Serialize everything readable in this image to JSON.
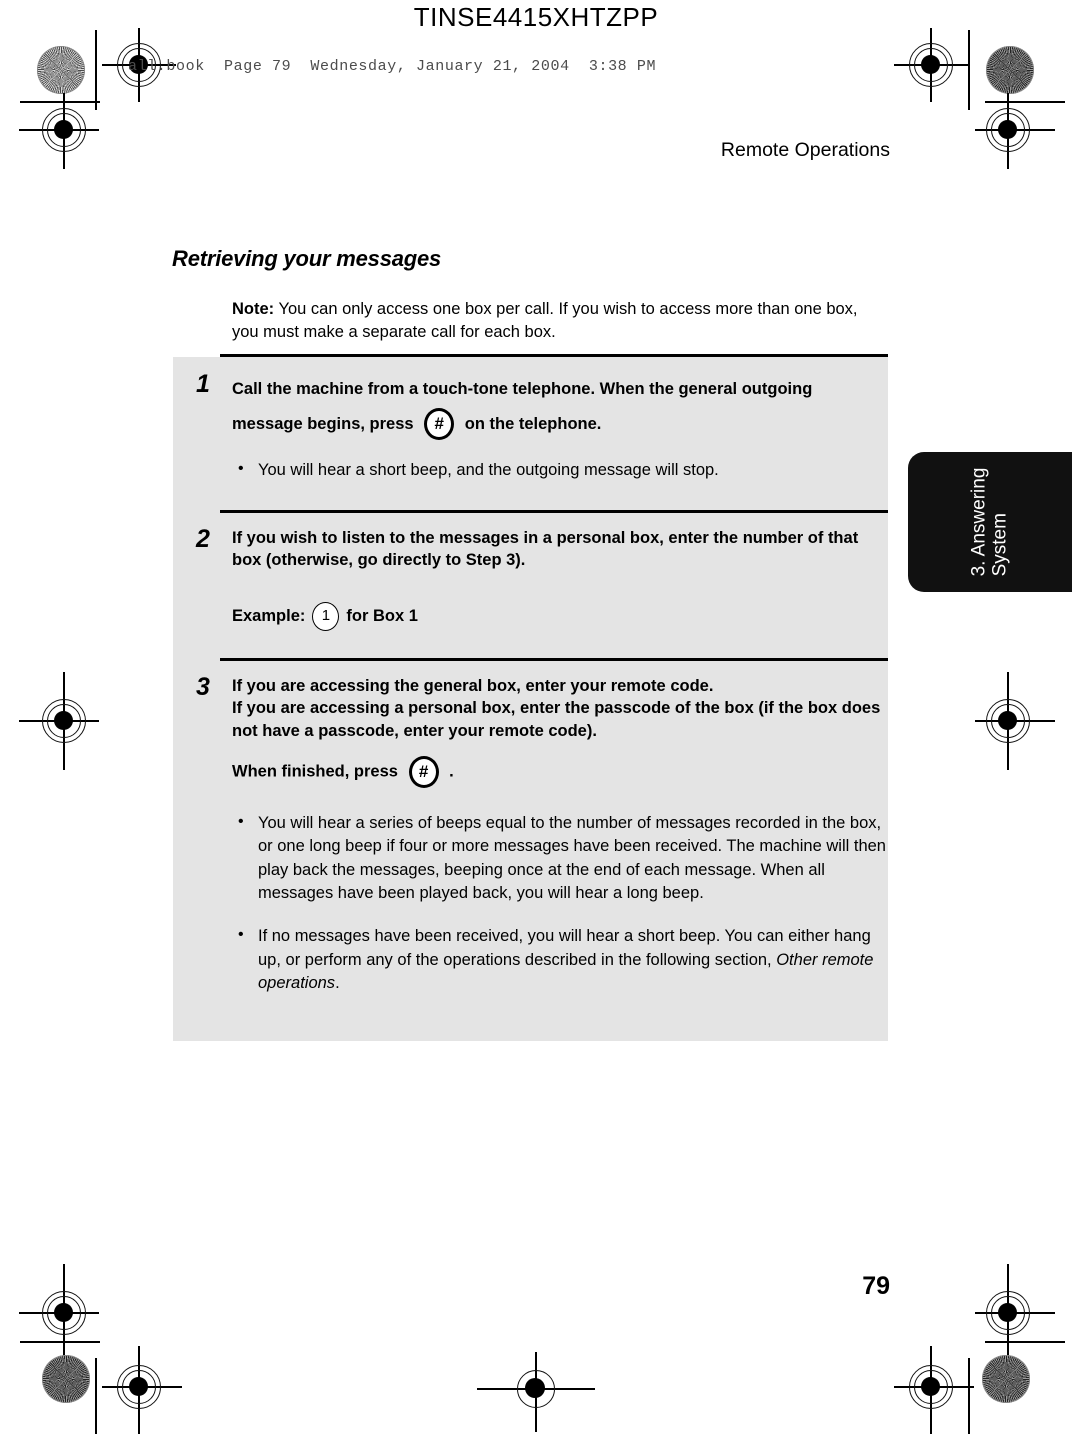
{
  "print_marks": {
    "part_number": "TINSE4415XHTZPP",
    "file_stamp": "all.book  Page 79  Wednesday, January 21, 2004  3:38 PM"
  },
  "page": {
    "running_head": "Remote Operations",
    "folio": "79",
    "thumb_tab": {
      "line1": "3. Answering",
      "line2": "System"
    }
  },
  "section": {
    "title": "Retrieving your messages",
    "note": {
      "label": "Note:",
      "text": " You can only access one box per call. If you wish to access more than one box, you must make a separate call for each box."
    }
  },
  "steps": [
    {
      "number": "1",
      "lead_before_key": "Call the machine from a touch-tone telephone. When the general outgoing message begins, press",
      "key": "#",
      "lead_after_key": "on the telephone.",
      "bullets": [
        "You will hear a short beep, and the outgoing message will stop."
      ]
    },
    {
      "number": "2",
      "lead": "If you wish to listen to the messages in a personal box, enter the number of that box (otherwise, go directly to Step 3).",
      "example_label": "Example:",
      "example_key": "1",
      "example_after": "for Box 1"
    },
    {
      "number": "3",
      "lead_line1": "If you are accessing the general box, enter your remote code.",
      "lead_line2": "If you are accessing a personal box, enter the passcode of the box (if the box does not have a passcode, enter your remote code).",
      "finish_before_key": "When finished, press",
      "key": "#",
      "finish_after_key": ".",
      "bullets": [
        "You will hear a series of beeps equal to the number of messages recorded in the box, or one long beep if four or more messages have been received. The machine will then play back the messages, beeping once at the end of each message. When all messages have been played back, you will hear a long beep."
      ],
      "bullet_last": {
        "before_italic": "If no messages have been received, you will hear a short beep. You can either hang up, or perform any of the operations described in the following section, ",
        "italic": "Other remote operations",
        "after_italic": "."
      }
    }
  ],
  "colors": {
    "panel_gray": "#e4e4e4",
    "tab_black": "#111111",
    "ink": "#000000"
  }
}
